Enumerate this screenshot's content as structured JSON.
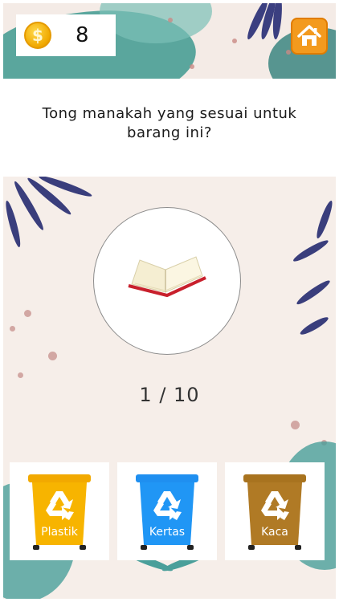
{
  "header": {
    "coin_symbol": "$",
    "coin_count": "8",
    "icons": {
      "coin": "coin-icon",
      "home": "home-icon"
    }
  },
  "question": "Tong manakah yang sesuai untuk barang ini?",
  "item": {
    "icon": "open-book-icon"
  },
  "progress": "1 / 10",
  "bins": [
    {
      "label": "Plastik",
      "color": "#f2a900",
      "icon": "recycle-icon"
    },
    {
      "label": "Kertas",
      "color": "#1f8ff0",
      "icon": "recycle-icon"
    },
    {
      "label": "Kaca",
      "color": "#b07a25",
      "icon": "recycle-icon"
    }
  ],
  "colors": {
    "home_button": "#f39a1e",
    "teal": "#3e9a8f",
    "leaf": "#3b3f80"
  }
}
